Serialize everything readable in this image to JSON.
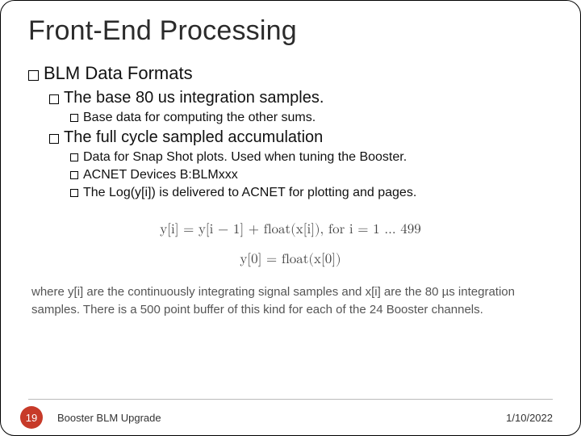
{
  "title": "Front-End Processing",
  "bullets": {
    "l1a": "BLM Data Formats",
    "l2a": "The base 80 us integration samples.",
    "l3a": "Base data for computing the other sums.",
    "l2b": "The full cycle sampled accumulation",
    "l3b": "Data for Snap Shot plots.  Used when tuning the Booster.",
    "l3c": "ACNET Devices B:BLMxxx",
    "l3d": "The Log(y[i]) is delivered to ACNET for plotting and pages."
  },
  "equations": {
    "line1": "y[i] = y[i − 1] + float(x[i]), for i = 1 … 499",
    "line2": "y[0] = float(x[0])"
  },
  "caption": "where y[i] are the continuously integrating signal samples and x[i] are the 80 µs integration samples.  There is a 500 point buffer of this kind for each of the 24 Booster channels.",
  "footer": {
    "page": "19",
    "label": "Booster BLM Upgrade",
    "date": "1/10/2022"
  }
}
